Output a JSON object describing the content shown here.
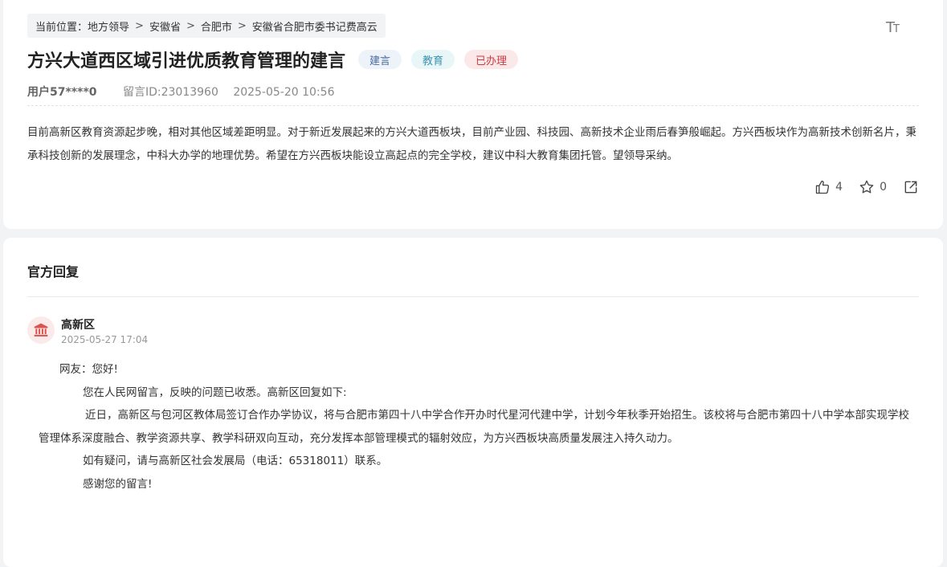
{
  "breadcrumb": {
    "prefix": "当前位置：",
    "items": [
      "地方领导",
      "安徽省",
      "合肥市",
      "安徽省合肥市委书记费高云"
    ],
    "separator": ">"
  },
  "font_size_toggle": "TT",
  "post": {
    "title": "方兴大道西区域引进优质教育管理的建言",
    "tags": {
      "type": "建言",
      "field": "教育",
      "status": "已办理"
    },
    "user": "用户57****0",
    "message_id": "留言ID:23013960",
    "datetime": "2025-05-20 10:56",
    "content": "目前高新区教育资源起步晚，相对其他区域差距明显。对于新近发展起来的方兴大道西板块，目前产业园、科技园、高新技术企业雨后春笋般崛起。方兴西板块作为高新技术创新名片，秉承科技创新的发展理念，中科大办学的地理优势。希望在方兴西板块能设立高起点的完全学校，建议中科大教育集团托管。望领导采纳。",
    "likes": "4",
    "favorites": "0"
  },
  "reply": {
    "heading": "官方回复",
    "org_name": "高新区",
    "datetime": "2025-05-27 17:04",
    "greeting": "网友：您好!",
    "para1": "您在人民网留言，反映的问题已收悉。高新区回复如下:",
    "para2": "近日，高新区与包河区教体局签订合作办学协议，将与合肥市第四十八中学合作开办时代星河代建中学，计划今年秋季开始招生。该校将与合肥市第四十八中学本部实现学校管理体系深度融合、教学资源共享、教学科研双向互动，充分发挥本部管理模式的辐射效应，为方兴西板块高质量发展注入持久动力。",
    "para3": "如有疑问，请与高新区社会发展局（电话：65318011）联系。",
    "closing": "感谢您的留言!"
  },
  "colors": {
    "tag_type": "#4a6aa0",
    "tag_field": "#3d93b2",
    "tag_status": "#cf3a3f",
    "avatar_bg": "#fbeaea",
    "avatar_icon": "#d9534f"
  },
  "icons": [
    "font-size-icon",
    "thumbs-up-icon",
    "star-icon",
    "share-icon",
    "government-building-icon"
  ]
}
